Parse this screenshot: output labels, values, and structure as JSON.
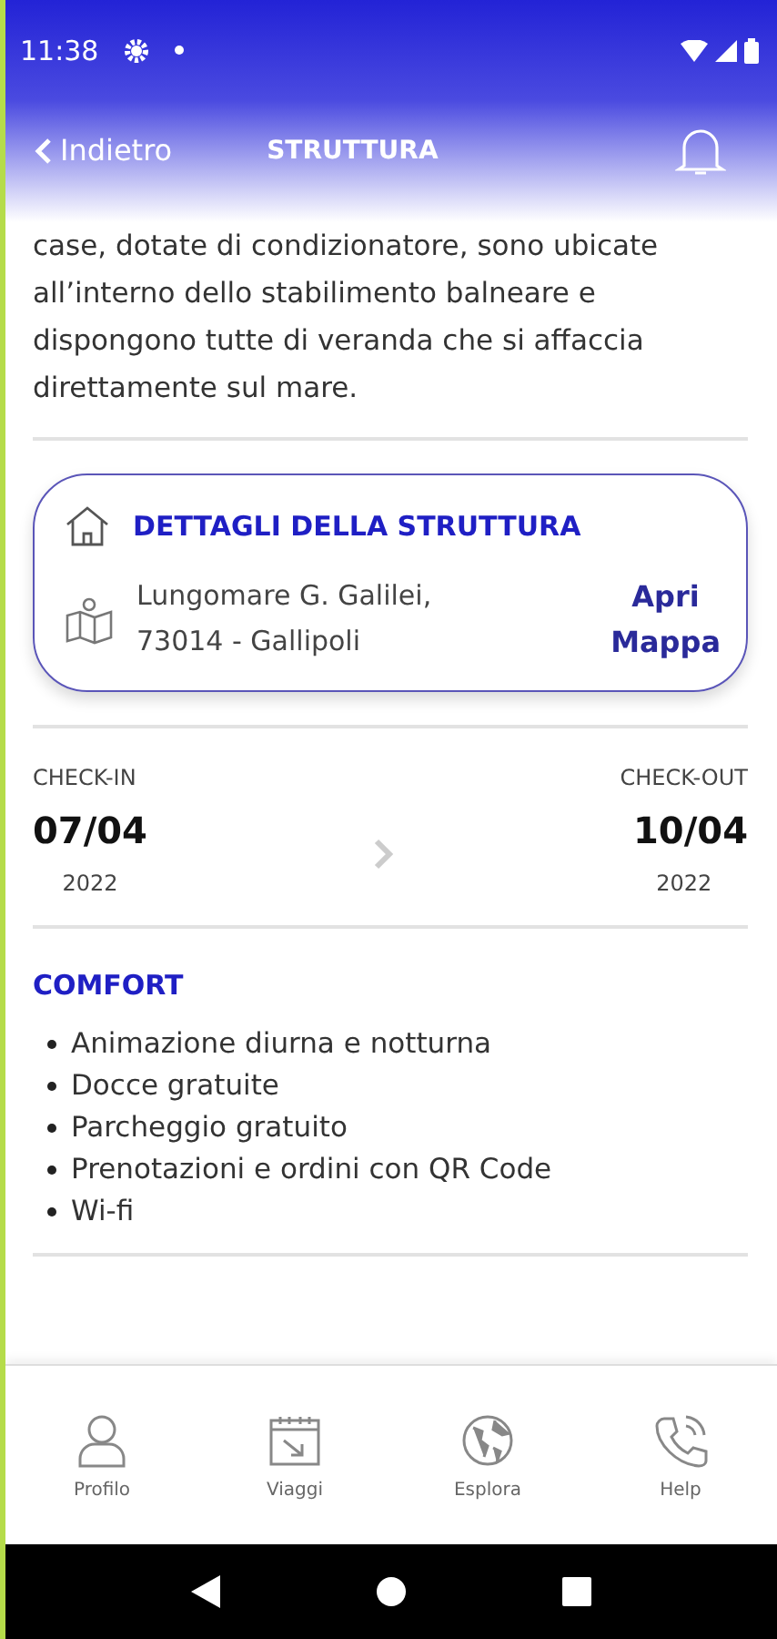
{
  "status_bar": {
    "time": "11:38"
  },
  "header": {
    "back": "Indietro",
    "title": "STRUTTURA"
  },
  "description": [
    "case, dotate di condizionatore, sono ubicate",
    "all’interno dello stabilimento balneare e",
    "dispongono tutte di veranda che si affaccia",
    "direttamente sul mare."
  ],
  "details_card": {
    "title": "DETTAGLI DELLA STRUTTURA",
    "address": [
      "Lungomare G. Galilei,",
      "73014 - Gallipoli"
    ],
    "map_link": [
      "Apri",
      "Mappa"
    ]
  },
  "stay": {
    "check_in": {
      "label": "CHECK-IN",
      "date": "07/04",
      "year": "2022"
    },
    "check_out": {
      "label": "CHECK-OUT",
      "date": "10/04",
      "year": "2022"
    }
  },
  "comfort": {
    "title": "COMFORT",
    "items": [
      "Animazione diurna e notturna",
      "Docce gratuite",
      "Parcheggio gratuito",
      "Prenotazioni e ordini con QR Code",
      "Wi-fi"
    ]
  },
  "bottom_nav": [
    {
      "kind": "user",
      "label": "Profilo"
    },
    {
      "kind": "calendar",
      "label": "Viaggi"
    },
    {
      "kind": "globe",
      "label": "Esplora"
    },
    {
      "kind": "phone",
      "label": "Help"
    }
  ]
}
